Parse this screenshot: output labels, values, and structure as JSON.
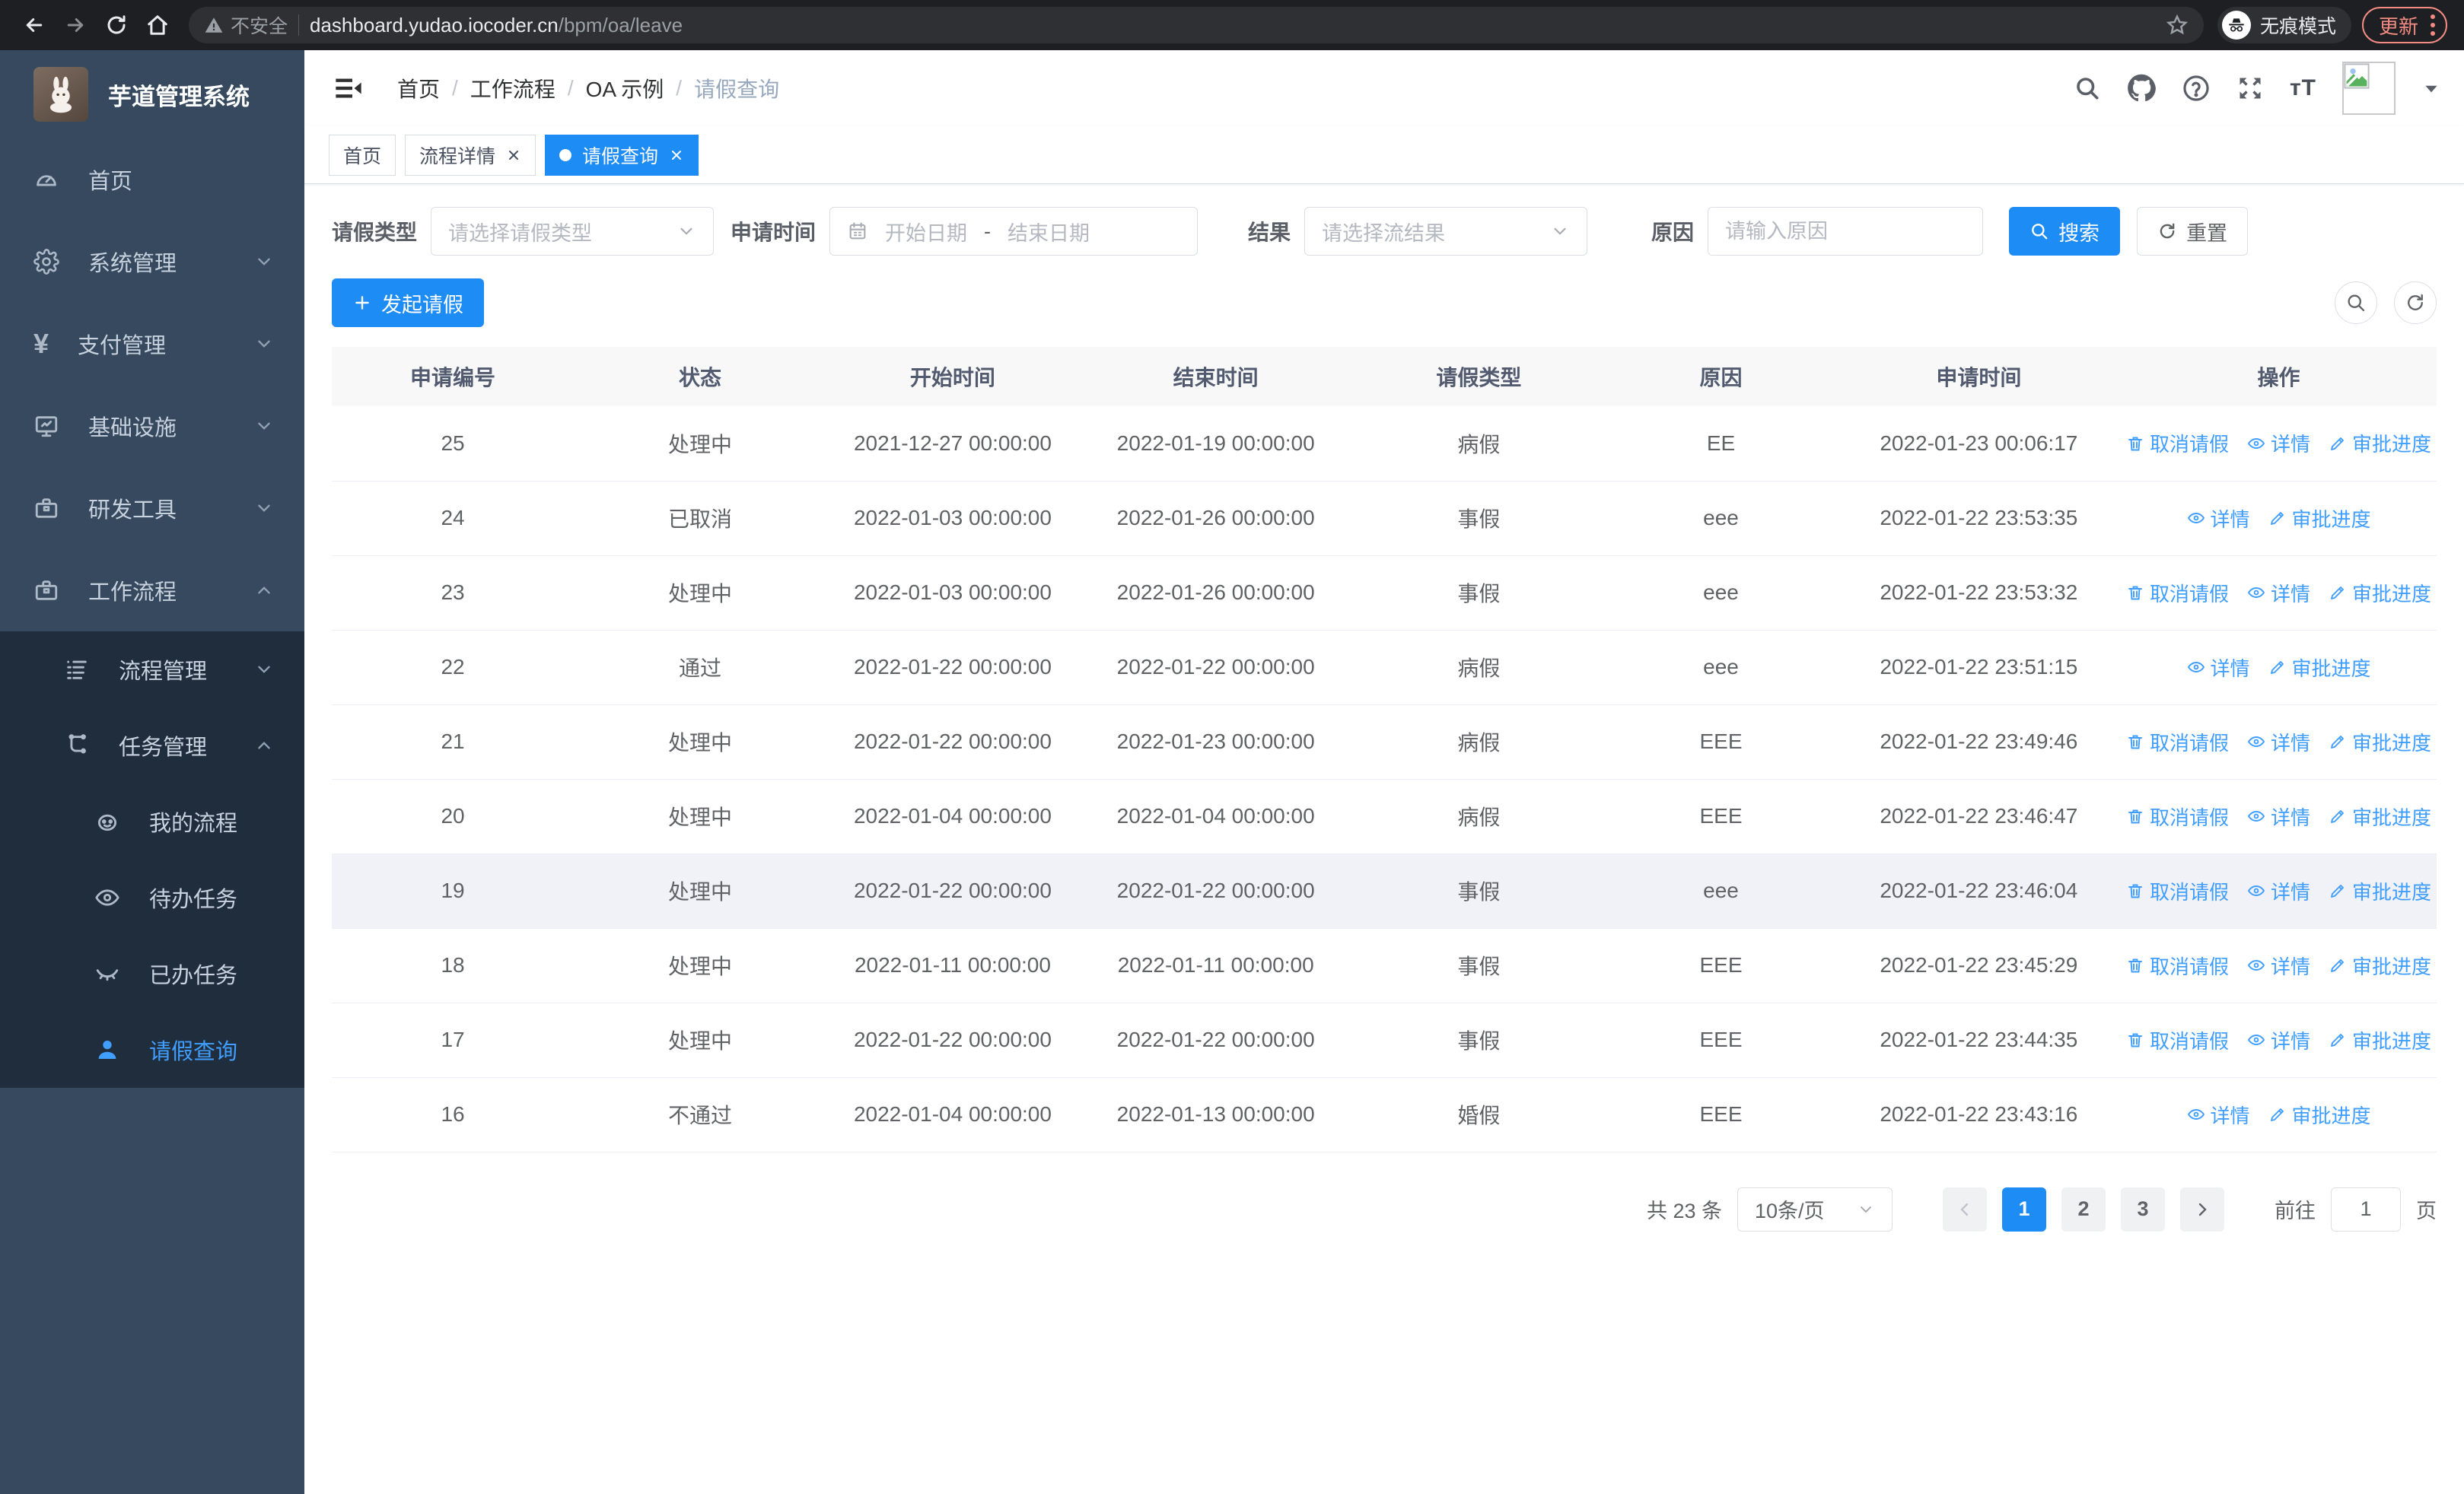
{
  "colors": {
    "primary": "#409eff",
    "button_blue": "#1d8cf5",
    "sidebar_bg": "#36495e",
    "submenu_bg": "#1f2d3d",
    "update_accent": "#f28b82",
    "table_border": "#ebeef5"
  },
  "browser": {
    "security_label": "不安全",
    "url_host": "dashboard.yudao.iocoder.cn",
    "url_path": "/bpm/oa/leave",
    "incognito_label": "无痕模式",
    "update_label": "更新"
  },
  "sidebar": {
    "app_title": "芋道管理系统",
    "menu": [
      {
        "label": "首页"
      },
      {
        "label": "系统管理"
      },
      {
        "label": "支付管理"
      },
      {
        "label": "基础设施"
      },
      {
        "label": "研发工具"
      },
      {
        "label": "工作流程"
      }
    ],
    "submenu": [
      {
        "label": "流程管理"
      },
      {
        "label": "任务管理"
      },
      {
        "label": "我的流程"
      },
      {
        "label": "待办任务"
      },
      {
        "label": "已办任务"
      },
      {
        "label": "请假查询"
      }
    ]
  },
  "breadcrumb": {
    "items": [
      "首页",
      "工作流程",
      "OA 示例",
      "请假查询"
    ],
    "separator": "/"
  },
  "tags": [
    {
      "label": "首页"
    },
    {
      "label": "流程详情"
    },
    {
      "label": "请假查询"
    }
  ],
  "filters": {
    "leave_type_label": "请假类型",
    "leave_type_placeholder": "请选择请假类型",
    "apply_time_label": "申请时间",
    "date_start_placeholder": "开始日期",
    "date_separator": "-",
    "date_end_placeholder": "结束日期",
    "result_label": "结果",
    "result_placeholder": "请选择流结果",
    "reason_label": "原因",
    "reason_placeholder": "请输入原因",
    "search_label": "搜索",
    "reset_label": "重置"
  },
  "toolbar": {
    "create_label": "发起请假"
  },
  "table": {
    "headers": [
      "申请编号",
      "状态",
      "开始时间",
      "结束时间",
      "请假类型",
      "原因",
      "申请时间",
      "操作"
    ],
    "action_labels": {
      "cancel": "取消请假",
      "detail": "详情",
      "progress": "审批进度"
    },
    "rows": [
      {
        "id": "25",
        "status": "处理中",
        "start": "2021-12-27 00:00:00",
        "end": "2022-01-19 00:00:00",
        "type": "病假",
        "reason": "EE",
        "apply": "2022-01-23 00:06:17",
        "cancelable": true
      },
      {
        "id": "24",
        "status": "已取消",
        "start": "2022-01-03 00:00:00",
        "end": "2022-01-26 00:00:00",
        "type": "事假",
        "reason": "eee",
        "apply": "2022-01-22 23:53:35",
        "cancelable": false
      },
      {
        "id": "23",
        "status": "处理中",
        "start": "2022-01-03 00:00:00",
        "end": "2022-01-26 00:00:00",
        "type": "事假",
        "reason": "eee",
        "apply": "2022-01-22 23:53:32",
        "cancelable": true
      },
      {
        "id": "22",
        "status": "通过",
        "start": "2022-01-22 00:00:00",
        "end": "2022-01-22 00:00:00",
        "type": "病假",
        "reason": "eee",
        "apply": "2022-01-22 23:51:15",
        "cancelable": false
      },
      {
        "id": "21",
        "status": "处理中",
        "start": "2022-01-22 00:00:00",
        "end": "2022-01-23 00:00:00",
        "type": "病假",
        "reason": "EEE",
        "apply": "2022-01-22 23:49:46",
        "cancelable": true
      },
      {
        "id": "20",
        "status": "处理中",
        "start": "2022-01-04 00:00:00",
        "end": "2022-01-04 00:00:00",
        "type": "病假",
        "reason": "EEE",
        "apply": "2022-01-22 23:46:47",
        "cancelable": true
      },
      {
        "id": "19",
        "status": "处理中",
        "start": "2022-01-22 00:00:00",
        "end": "2022-01-22 00:00:00",
        "type": "事假",
        "reason": "eee",
        "apply": "2022-01-22 23:46:04",
        "cancelable": true,
        "highlight": true
      },
      {
        "id": "18",
        "status": "处理中",
        "start": "2022-01-11 00:00:00",
        "end": "2022-01-11 00:00:00",
        "type": "事假",
        "reason": "EEE",
        "apply": "2022-01-22 23:45:29",
        "cancelable": true
      },
      {
        "id": "17",
        "status": "处理中",
        "start": "2022-01-22 00:00:00",
        "end": "2022-01-22 00:00:00",
        "type": "事假",
        "reason": "EEE",
        "apply": "2022-01-22 23:44:35",
        "cancelable": true
      },
      {
        "id": "16",
        "status": "不通过",
        "start": "2022-01-04 00:00:00",
        "end": "2022-01-13 00:00:00",
        "type": "婚假",
        "reason": "EEE",
        "apply": "2022-01-22 23:43:16",
        "cancelable": false
      }
    ]
  },
  "pagination": {
    "total": "共 23 条",
    "page_size": "10条/页",
    "pages": [
      "1",
      "2",
      "3"
    ],
    "active_page": "1",
    "goto_label": "前往",
    "goto_value": "1",
    "page_unit": "页"
  }
}
